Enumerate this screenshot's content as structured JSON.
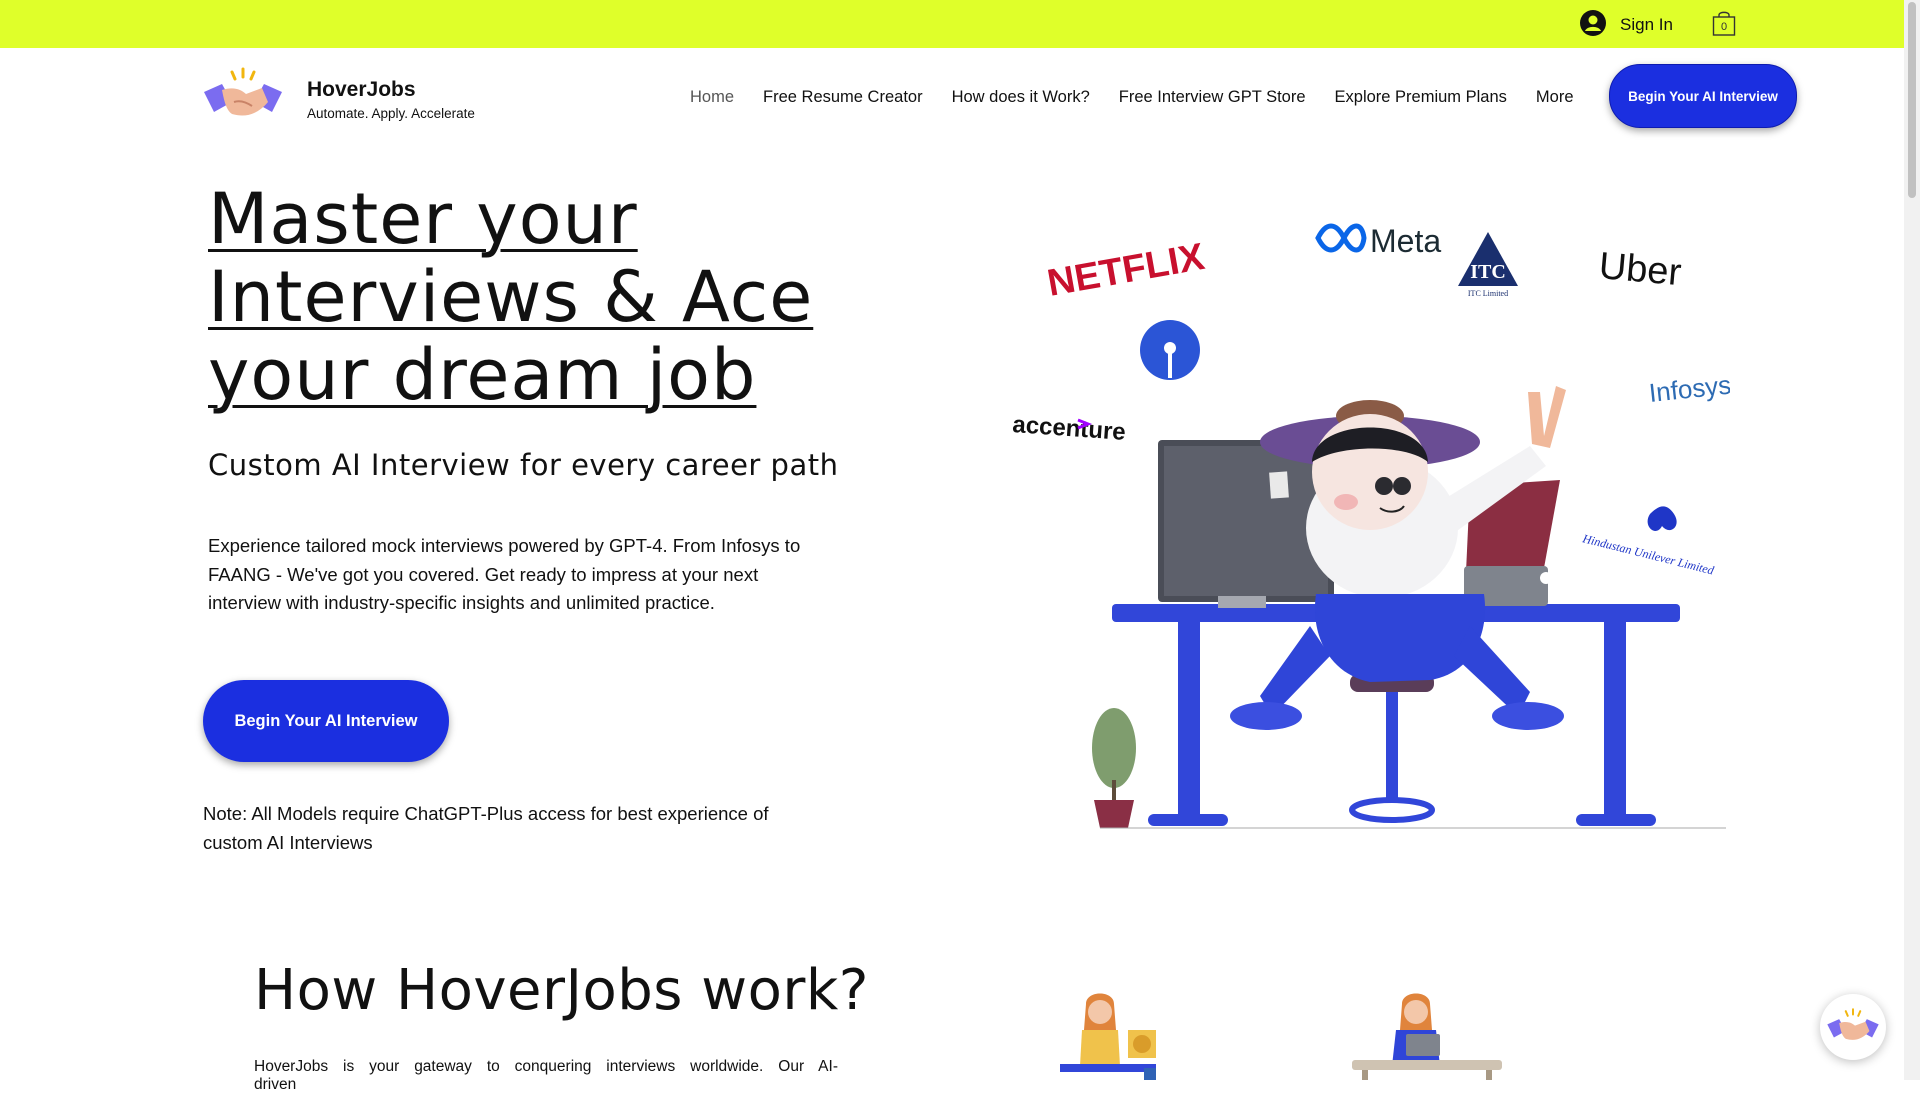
{
  "topbar": {
    "sign_in": "Sign In",
    "cart_count": "0",
    "bg_color": "#dfff2a"
  },
  "brand": {
    "name": "HoverJobs",
    "tagline": "Automate. Apply. Accelerate",
    "logo_icon": "handshake-icon"
  },
  "nav": {
    "items": [
      {
        "label": "Home",
        "active": true
      },
      {
        "label": "Free Resume Creator"
      },
      {
        "label": "How does it Work?"
      },
      {
        "label": "Free Interview GPT Store"
      },
      {
        "label": "Explore Premium Plans"
      },
      {
        "label": "More"
      }
    ],
    "cta": "Begin Your AI Interview"
  },
  "hero": {
    "title_lines": [
      "Master your",
      "Interviews & Ace",
      "your dream job"
    ],
    "subtitle": "Custom AI Interview for every career path",
    "body": "Experience tailored mock interviews powered by GPT-4. From Infosys to FAANG - We've got you covered. Get ready to impress at your next interview with industry-specific insights and unlimited practice.",
    "cta": "Begin Your AI Interview",
    "note": "Note: All Models require ChatGPT-Plus access for best experience of custom AI Interviews",
    "accent_color": "#1b2fe0"
  },
  "illustration": {
    "company_logos": [
      "Meta",
      "NETFLIX",
      "ITC Limited",
      "Uber",
      "Infosys",
      "accenture",
      "Hindustan Unilever Limited"
    ]
  },
  "how_it_works": {
    "title": "How HoverJobs work?",
    "body": "HoverJobs is your gateway to conquering interviews worldwide. Our AI-driven"
  }
}
